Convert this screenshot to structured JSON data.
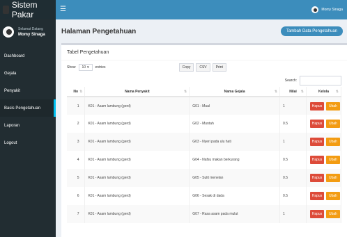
{
  "app": {
    "title": "Sistem Pakar"
  },
  "user": {
    "greeting": "Selamat Datang",
    "name": "Momy Sinaga"
  },
  "topbar": {
    "username": "Momy Sinaga"
  },
  "nav": [
    {
      "label": "Dashboard"
    },
    {
      "label": "Gejala"
    },
    {
      "label": "Penyakit"
    },
    {
      "label": "Basis Pengetahuan"
    },
    {
      "label": "Laporan"
    },
    {
      "label": "Logout"
    }
  ],
  "page": {
    "title": "Halaman Pengetahuan",
    "add_button": "Tambah Data Pengetahuan"
  },
  "box": {
    "title": "Tabel Pengetahuan"
  },
  "controls": {
    "show_label": "Show",
    "entries_value": "10",
    "entries_label": "entries",
    "buttons": [
      "Copy",
      "CSV",
      "Print"
    ],
    "search_label": "Search:"
  },
  "table": {
    "headers": [
      "No",
      "Nama Penyakit",
      "Nama Gejala",
      "Nilai",
      "Kelola"
    ],
    "action_delete": "Hapus",
    "action_edit": "Ubah",
    "rows": [
      {
        "no": "1",
        "penyakit": "K01 - Asam lambung (gerd)",
        "gejala": "G01 - Mual",
        "nilai": "1"
      },
      {
        "no": "2",
        "penyakit": "K01 - Asam lambung (gerd)",
        "gejala": "G02 - Muntah",
        "nilai": "0.5"
      },
      {
        "no": "3",
        "penyakit": "K01 - Asam lambung (gerd)",
        "gejala": "G03 - Nyeri pada ulu hati",
        "nilai": "1"
      },
      {
        "no": "4",
        "penyakit": "K01 - Asam lambung (gerd)",
        "gejala": "G04 - Nafsu makan berkurang",
        "nilai": "0.5"
      },
      {
        "no": "5",
        "penyakit": "K01 - Asam lambung (gerd)",
        "gejala": "G05 - Sulit menelan",
        "nilai": "0.5"
      },
      {
        "no": "6",
        "penyakit": "K01 - Asam lambung (gerd)",
        "gejala": "G06 - Sesak di dada",
        "nilai": "0.5"
      },
      {
        "no": "7",
        "penyakit": "K01 - Asam lambung (gerd)",
        "gejala": "G07 - Rasa asam pada mulut",
        "nilai": "1"
      }
    ]
  }
}
